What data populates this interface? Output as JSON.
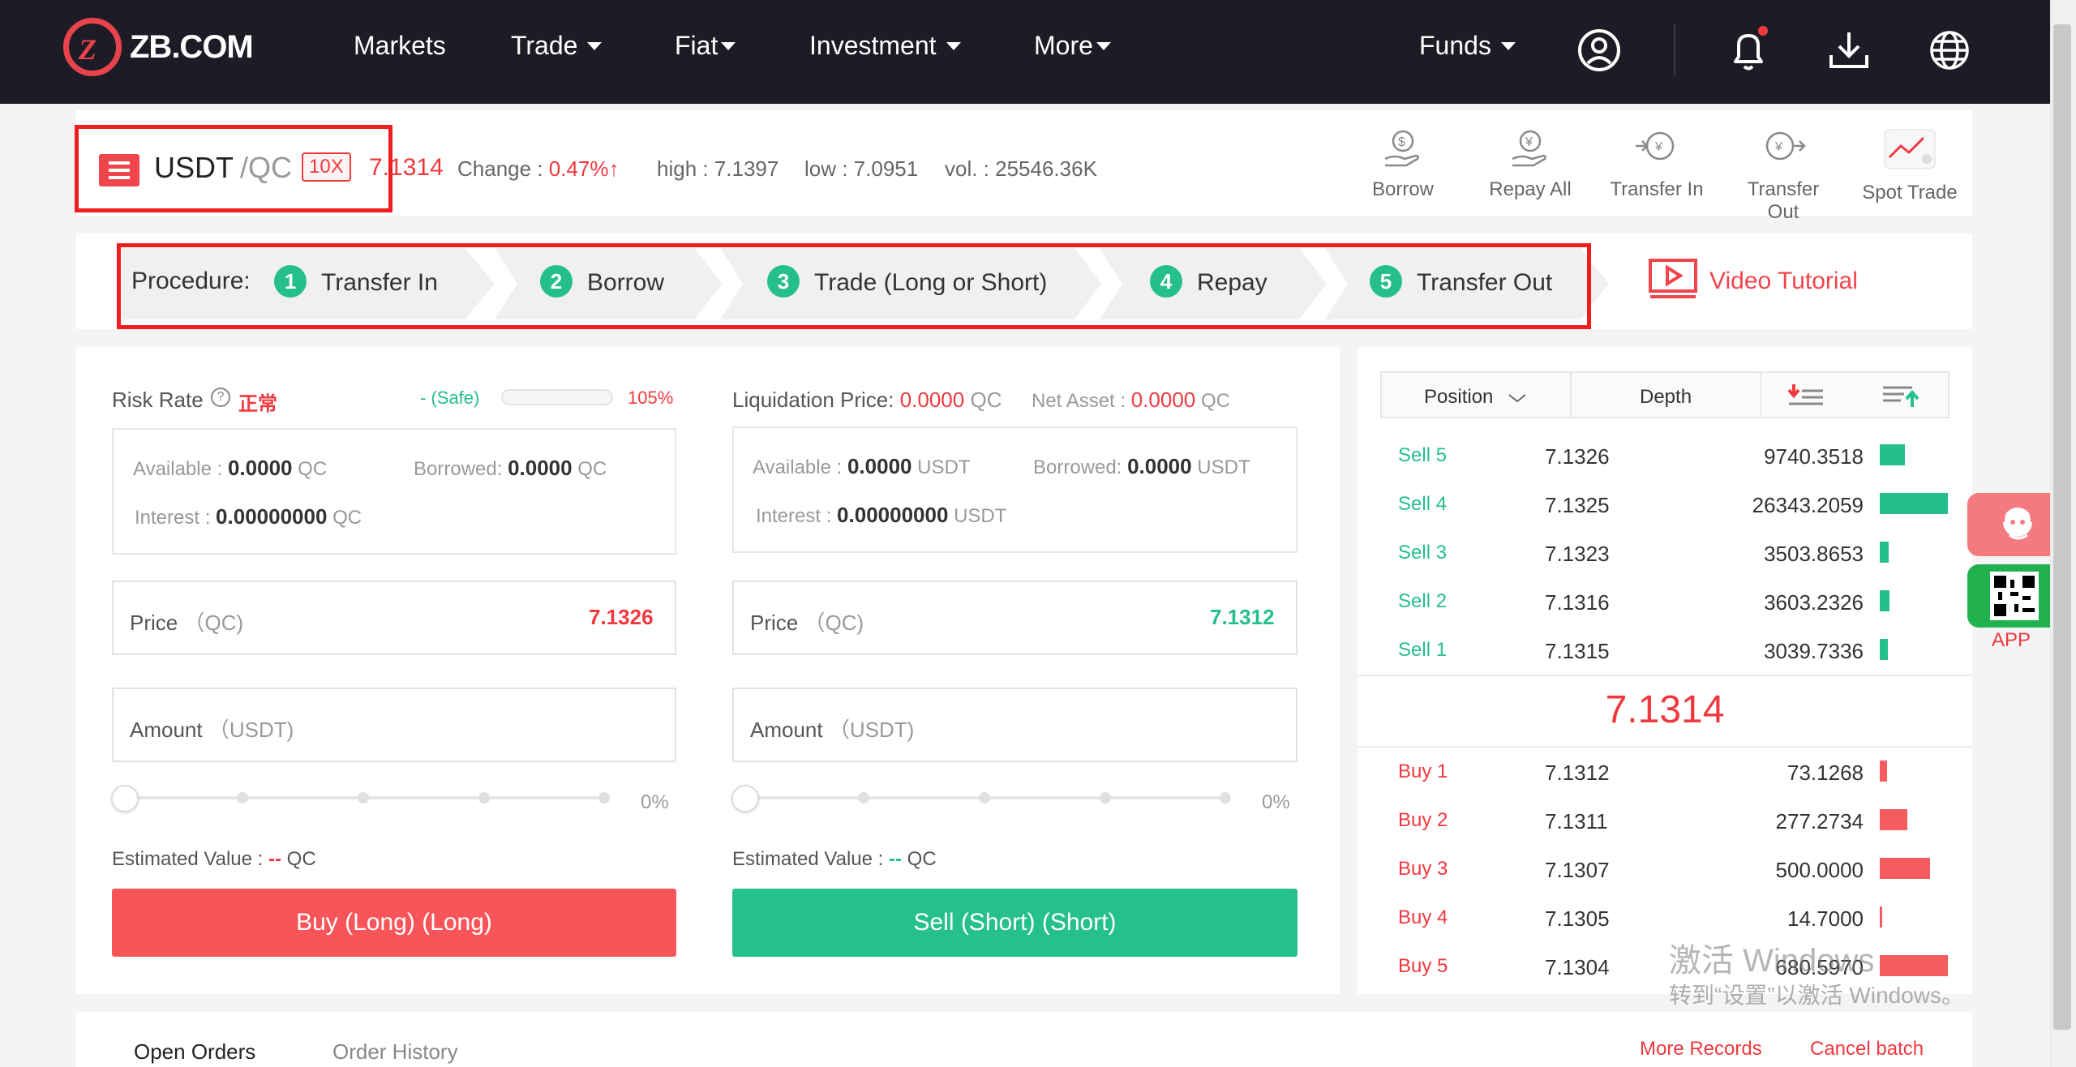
{
  "brand": {
    "logo_text": "ZB.COM",
    "logo_mark": "Z"
  },
  "nav": {
    "items": [
      {
        "label": "Markets",
        "caret": false
      },
      {
        "label": "Trade",
        "caret": true
      },
      {
        "label": "Fiat",
        "caret": true
      },
      {
        "label": "Investment",
        "caret": true
      },
      {
        "label": "More",
        "caret": true
      }
    ],
    "funds": "Funds"
  },
  "ticker": {
    "base": "USDT",
    "quote": "/QC",
    "leverage": "10X",
    "last_price": "7.1314",
    "change_label": "Change :",
    "change_value": "0.47%",
    "change_arrow": "↑",
    "high": "high : 7.1397",
    "low": "low : 7.0951",
    "vol": "vol. : 25546.36K"
  },
  "actions": [
    "Borrow",
    "Repay All",
    "Transfer In",
    "Transfer Out",
    "Spot Trade"
  ],
  "procedure": {
    "label": "Procedure:",
    "steps": [
      {
        "num": "1",
        "label": "Transfer In"
      },
      {
        "num": "2",
        "label": "Borrow"
      },
      {
        "num": "3",
        "label": "Trade (Long or Short)"
      },
      {
        "num": "4",
        "label": "Repay"
      },
      {
        "num": "5",
        "label": "Transfer Out"
      }
    ],
    "video": "Video Tutorial"
  },
  "buy_panel": {
    "risk_label": "Risk Rate",
    "risk_status": "正常",
    "safe": "- (Safe)",
    "risk_pct": "105%",
    "available_label": "Available :",
    "available_value": "0.0000",
    "available_unit": "QC",
    "borrowed_label": "Borrowed:",
    "borrowed_value": "0.0000",
    "borrowed_unit": "QC",
    "interest_label": "Interest :",
    "interest_value": "0.00000000",
    "interest_unit": "QC",
    "price_label": "Price",
    "price_unit": "（QC)",
    "price_value": "7.1326",
    "amount_label": "Amount",
    "amount_unit": "（USDT)",
    "slider_pct": "0%",
    "est_label": "Estimated Value :",
    "est_value": "--",
    "est_unit": "QC",
    "button": "Buy (Long) (Long)"
  },
  "sell_panel": {
    "liq_label": "Liquidation Price:",
    "liq_value": "0.0000",
    "liq_unit": "QC",
    "net_label": "Net Asset :",
    "net_value": "0.0000",
    "net_unit": "QC",
    "available_label": "Available :",
    "available_value": "0.0000",
    "available_unit": "USDT",
    "borrowed_label": "Borrowed:",
    "borrowed_value": "0.0000",
    "borrowed_unit": "USDT",
    "interest_label": "Interest :",
    "interest_value": "0.00000000",
    "interest_unit": "USDT",
    "price_label": "Price",
    "price_unit": "（QC)",
    "price_value": "7.1312",
    "amount_label": "Amount",
    "amount_unit": "（USDT)",
    "slider_pct": "0%",
    "est_label": "Estimated Value :",
    "est_value": "--",
    "est_unit": "QC",
    "button": "Sell (Short) (Short)"
  },
  "orderbook": {
    "tab_position": "Position",
    "tab_depth": "Depth",
    "asks": [
      {
        "label": "Sell 5",
        "price": "7.1326",
        "amount": "9740.3518",
        "depth": 0.37
      },
      {
        "label": "Sell 4",
        "price": "7.1325",
        "amount": "26343.2059",
        "depth": 1.0
      },
      {
        "label": "Sell 3",
        "price": "7.1323",
        "amount": "3503.8653",
        "depth": 0.13
      },
      {
        "label": "Sell 2",
        "price": "7.1316",
        "amount": "3603.2326",
        "depth": 0.14
      },
      {
        "label": "Sell 1",
        "price": "7.1315",
        "amount": "3039.7336",
        "depth": 0.12
      }
    ],
    "mid_price": "7.1314",
    "bids": [
      {
        "label": "Buy 1",
        "price": "7.1312",
        "amount": "73.1268",
        "depth": 0.11
      },
      {
        "label": "Buy 2",
        "price": "7.1311",
        "amount": "277.2734",
        "depth": 0.41
      },
      {
        "label": "Buy 3",
        "price": "7.1307",
        "amount": "500.0000",
        "depth": 0.74
      },
      {
        "label": "Buy 4",
        "price": "7.1305",
        "amount": "14.7000",
        "depth": 0.03
      },
      {
        "label": "Buy 5",
        "price": "7.1304",
        "amount": "680.5970",
        "depth": 1.0
      }
    ]
  },
  "side_widgets": {
    "app": "APP"
  },
  "bottom": {
    "tabs": [
      "Open Orders",
      "Order History"
    ],
    "more": "More Records",
    "cancel": "Cancel batch"
  },
  "watermark": {
    "line1": "激活 Windows",
    "line2": "转到“设置”以激活 Windows。"
  },
  "colors": {
    "red": "#f0393f",
    "green": "#25bf8a",
    "nav_bg": "#1d1c26"
  }
}
